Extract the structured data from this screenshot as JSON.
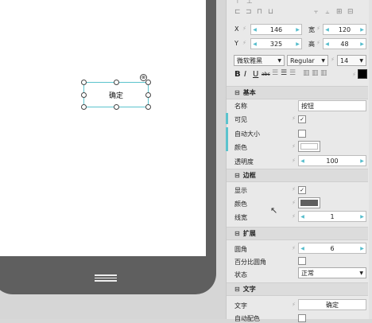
{
  "widget": {
    "label": "确定"
  },
  "geometry": {
    "x_label": "X",
    "x_value": "146",
    "y_label": "Y",
    "y_value": "325",
    "w_label": "宽",
    "w_value": "120",
    "h_label": "高",
    "h_value": "48"
  },
  "font": {
    "family": "微软雅黑",
    "style": "Regular",
    "size": "14"
  },
  "format_buttons": [
    "B",
    "I",
    "U",
    "abc"
  ],
  "sections": {
    "basic": {
      "title": "基本",
      "name_label": "名称",
      "name_value": "按钮",
      "visible_label": "可见",
      "autosize_label": "自动大小",
      "color_label": "颜色",
      "opacity_label": "透明度",
      "opacity_value": "100"
    },
    "border": {
      "title": "边框",
      "show_label": "显示",
      "color_label": "颜色",
      "width_label": "线宽",
      "width_value": "1"
    },
    "extend": {
      "title": "扩展",
      "radius_label": "圆角",
      "radius_value": "6",
      "percent_radius_label": "百分比圆角",
      "state_label": "状态",
      "state_value": "正常"
    },
    "text": {
      "title": "文字",
      "text_label": "文字",
      "text_value": "确定",
      "autocolor_label": "自动配色"
    }
  },
  "colors": {
    "accent": "#5bc3cd",
    "border_color": "#5f5f5f"
  }
}
